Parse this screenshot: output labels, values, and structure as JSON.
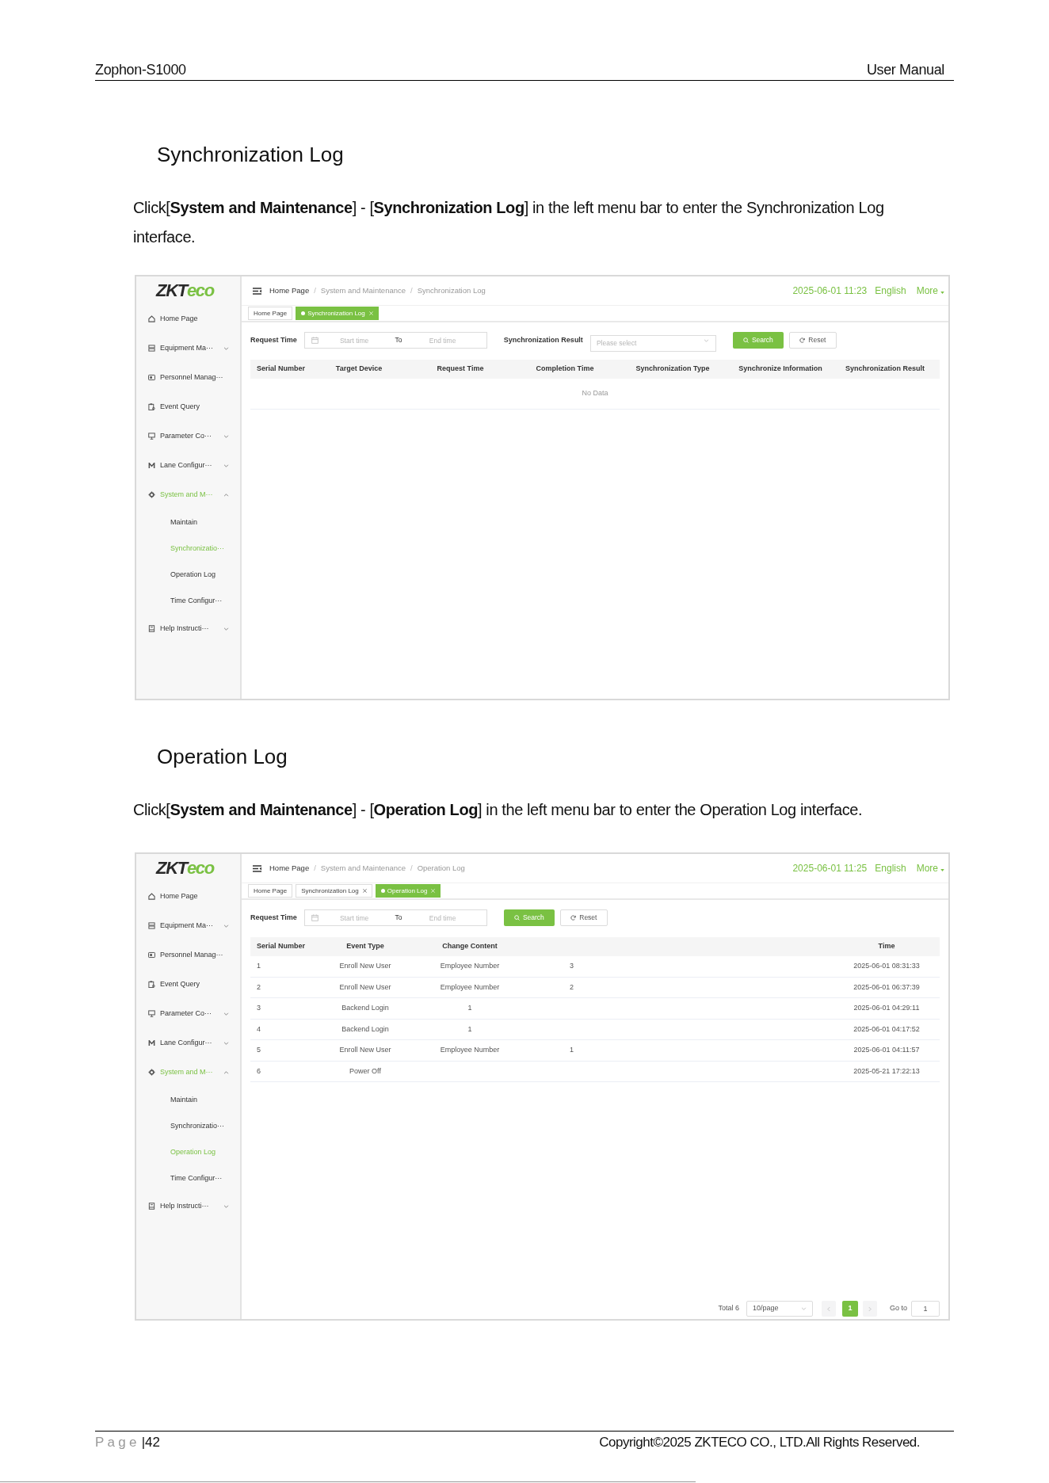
{
  "page_header": {
    "product": "Zophon-S1000",
    "document": "User Manual"
  },
  "sections": [
    {
      "heading": "Synchronization Log",
      "intro": "Click[**System and Maintenance**] - [**Synchronization Log**] in the left menu bar to enter the Synchronization Log interface.",
      "screenshot": {
        "logo": [
          "ZKT",
          "eco"
        ],
        "sidebar": {
          "items": [
            {
              "kind": "page",
              "label": "Home Page",
              "selected": false
            },
            {
              "kind": "group",
              "label": "Equipment Ma···",
              "selected": false,
              "expanded": false
            },
            {
              "kind": "page",
              "label": "Personnel Manag···",
              "selected": false
            },
            {
              "kind": "page",
              "label": "Event Query",
              "selected": false
            },
            {
              "kind": "group",
              "label": "Parameter Co···",
              "selected": false,
              "expanded": false
            },
            {
              "kind": "group",
              "label": "Lane Configur···",
              "selected": false,
              "expanded": false
            },
            {
              "kind": "group",
              "label": "System and M···",
              "selected": true,
              "expanded": true,
              "children": [
                {
                  "label": "Maintain",
                  "selected": false
                },
                {
                  "label": "Synchronizatio···",
                  "selected": true
                },
                {
                  "label": "Operation Log",
                  "selected": false
                },
                {
                  "label": "Time Configur···",
                  "selected": false
                }
              ]
            },
            {
              "kind": "group",
              "label": "Help Instructi···",
              "selected": false,
              "expanded": false
            }
          ]
        },
        "breadcrumb": {
          "items": [
            "Home Page",
            "System and Maintenance",
            "Synchronization Log"
          ],
          "separator": "/"
        },
        "datetime": "2025-06-01 11:23",
        "language": "English",
        "more": "More",
        "tabs": [
          {
            "label": "Home Page",
            "selected": false,
            "closable": false
          },
          {
            "label": "Synchronization Log",
            "selected": true,
            "closable": true
          }
        ],
        "filters": [
          {
            "kind": "date_range",
            "label": "Request Time",
            "start_placeholder": "Start time",
            "separator": "To",
            "end_placeholder": "End time"
          },
          {
            "kind": "select",
            "label": "Synchronization Result",
            "placeholder": "Please select"
          }
        ],
        "buttons": [
          {
            "kind": "primary",
            "label": "Search"
          },
          {
            "kind": "default",
            "label": "Reset"
          }
        ],
        "table": {
          "columns": [
            "Serial Number",
            "Target Device",
            "Request Time",
            "Completion Time",
            "Synchronization Type",
            "Synchronize Information",
            "Synchronization Result"
          ],
          "empty_text": "No Data"
        }
      }
    },
    {
      "heading": "Operation Log",
      "intro": "Click[**System and Maintenance**] - [**Operation Log**] in the left menu bar to enter the Operation Log interface.",
      "screenshot": {
        "logo": [
          "ZKT",
          "eco"
        ],
        "sidebar": {
          "items": [
            {
              "kind": "page",
              "label": "Home Page",
              "selected": false
            },
            {
              "kind": "group",
              "label": "Equipment Ma···",
              "selected": false,
              "expanded": false
            },
            {
              "kind": "page",
              "label": "Personnel Manag···",
              "selected": false
            },
            {
              "kind": "page",
              "label": "Event Query",
              "selected": false
            },
            {
              "kind": "group",
              "label": "Parameter Co···",
              "selected": false,
              "expanded": false
            },
            {
              "kind": "group",
              "label": "Lane Configur···",
              "selected": false,
              "expanded": false
            },
            {
              "kind": "group",
              "label": "System and M···",
              "selected": true,
              "expanded": true,
              "children": [
                {
                  "label": "Maintain",
                  "selected": false
                },
                {
                  "label": "Synchronizatio···",
                  "selected": false
                },
                {
                  "label": "Operation Log",
                  "selected": true
                },
                {
                  "label": "Time Configur···",
                  "selected": false
                }
              ]
            },
            {
              "kind": "group",
              "label": "Help Instructi···",
              "selected": false,
              "expanded": false
            }
          ]
        },
        "breadcrumb": {
          "items": [
            "Home Page",
            "System and Maintenance",
            "Operation Log"
          ],
          "separator": "/"
        },
        "datetime": "2025-06-01 11:25",
        "language": "English",
        "more": "More",
        "tabs": [
          {
            "label": "Home Page",
            "selected": false,
            "closable": false
          },
          {
            "label": "Synchronization Log",
            "selected": false,
            "closable": true
          },
          {
            "label": "Operation Log",
            "selected": true,
            "closable": true
          }
        ],
        "filters": [
          {
            "kind": "date_range",
            "label": "Request Time",
            "start_placeholder": "Start time",
            "separator": "To",
            "end_placeholder": "End time"
          }
        ],
        "buttons": [
          {
            "kind": "primary",
            "label": "Search"
          },
          {
            "kind": "default",
            "label": "Reset"
          }
        ],
        "table": {
          "columns": [
            "Serial Number",
            "Event Type",
            "Change Content",
            "Time"
          ],
          "rows": [
            {
              "serial_number": "1",
              "event_type": "Enroll New User",
              "change_content": "Employee Number",
              "column_4": "3",
              "time": "2025-06-01 08:31:33"
            },
            {
              "serial_number": "2",
              "event_type": "Enroll New User",
              "change_content": "Employee Number",
              "column_4": "2",
              "time": "2025-06-01 06:37:39"
            },
            {
              "serial_number": "3",
              "event_type": "Backend Login",
              "change_content": "1",
              "time": "2025-06-01 04:29:11"
            },
            {
              "serial_number": "4",
              "event_type": "Backend Login",
              "change_content": "1",
              "time": "2025-06-01 04:17:52"
            },
            {
              "serial_number": "5",
              "event_type": "Enroll New User",
              "change_content": "Employee Number",
              "column_4": "1",
              "time": "2025-06-01 04:11:57"
            },
            {
              "serial_number": "6",
              "event_type": "Power Off",
              "time": "2025-05-21 17:22:13"
            }
          ]
        },
        "pagination": {
          "total": "Total 6",
          "page_size": "10/page",
          "pages": [
            {
              "label": "1",
              "selected": true
            }
          ],
          "goto_label": "Go to",
          "goto_value": "1"
        }
      }
    }
  ],
  "footer": {
    "page_label": "Page",
    "page_number": "|42",
    "copyright": "Copyright©2025 ZKTECO CO., LTD.All Rights Reserved."
  }
}
